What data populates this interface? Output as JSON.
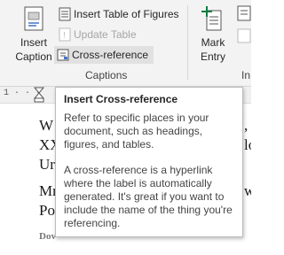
{
  "ribbon": {
    "insert_caption": {
      "line1": "Insert",
      "line2": "Caption"
    },
    "insert_table_of_figures": "Insert Table of Figures",
    "update_table": "Update Table",
    "cross_reference": "Cross-reference",
    "captions_group": "Captions",
    "mark_entry": {
      "line1": "Mark",
      "line2": "Entry"
    },
    "next_group_partial": "In"
  },
  "ruler": {
    "text": "1 · · ·"
  },
  "document": {
    "lines": [
      "W",
      "XX",
      "Ur",
      "Mr",
      "Po"
    ],
    "small_text": "Dov",
    "right_fragments": [
      ",",
      "lo",
      "w"
    ]
  },
  "tooltip": {
    "title": "Insert Cross-reference",
    "para1": "Refer to specific places in your document, such as headings, figures, and tables.",
    "para2": "A cross-reference is a hyperlink where the label is automatically generated. It's great if you want to include the name of the thing you're referencing."
  },
  "colors": {
    "accent_green": "#107c41",
    "highlight": "#e1e1e1"
  }
}
